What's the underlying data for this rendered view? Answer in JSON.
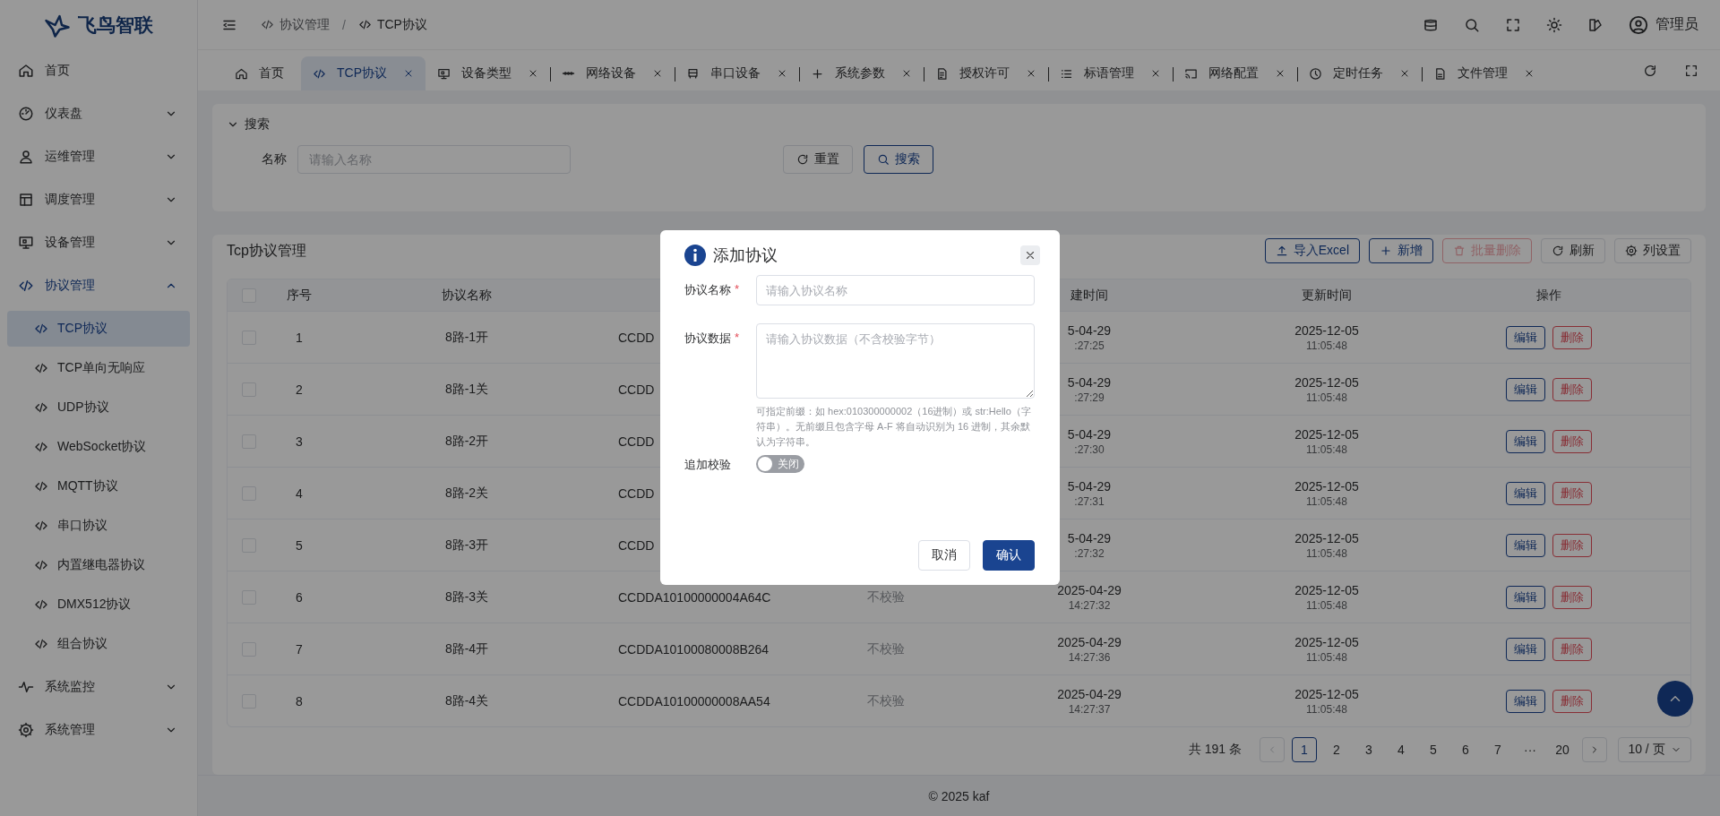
{
  "logo": {
    "text": "飞鸟智联"
  },
  "sidebar": {
    "items": [
      {
        "label": "首页",
        "kind": "link"
      },
      {
        "label": "仪表盘",
        "kind": "group",
        "expanded": false
      },
      {
        "label": "运维管理",
        "kind": "group",
        "expanded": false
      },
      {
        "label": "调度管理",
        "kind": "group",
        "expanded": false
      },
      {
        "label": "设备管理",
        "kind": "group",
        "expanded": false
      },
      {
        "label": "协议管理",
        "kind": "group",
        "expanded": true,
        "children": [
          {
            "label": "TCP协议",
            "selected": true
          },
          {
            "label": "TCP单向无响应",
            "selected": false
          },
          {
            "label": "UDP协议",
            "selected": false
          },
          {
            "label": "WebSocket协议",
            "selected": false
          },
          {
            "label": "MQTT协议",
            "selected": false
          },
          {
            "label": "串口协议",
            "selected": false
          },
          {
            "label": "内置继电器协议",
            "selected": false
          },
          {
            "label": "DMX512协议",
            "selected": false
          },
          {
            "label": "组合协议",
            "selected": false
          }
        ]
      },
      {
        "label": "系统监控",
        "kind": "group",
        "expanded": false
      },
      {
        "label": "系统管理",
        "kind": "group",
        "expanded": false
      }
    ]
  },
  "header": {
    "breadcrumb": [
      "协议管理",
      "TCP协议"
    ],
    "separator": "/",
    "user": "管理员"
  },
  "tabs": [
    {
      "label": "首页",
      "selected": false,
      "closable": false
    },
    {
      "label": "TCP协议",
      "selected": true,
      "closable": true
    },
    {
      "label": "设备类型",
      "selected": false,
      "closable": true
    },
    {
      "label": "网络设备",
      "selected": false,
      "closable": true
    },
    {
      "label": "串口设备",
      "selected": false,
      "closable": true
    },
    {
      "label": "系统参数",
      "selected": false,
      "closable": true
    },
    {
      "label": "授权许可",
      "selected": false,
      "closable": true
    },
    {
      "label": "标语管理",
      "selected": false,
      "closable": true
    },
    {
      "label": "网络配置",
      "selected": false,
      "closable": true
    },
    {
      "label": "定时任务",
      "selected": false,
      "closable": true
    },
    {
      "label": "文件管理",
      "selected": false,
      "closable": true
    }
  ],
  "search": {
    "title": "搜索",
    "expanded": true,
    "fields": [
      {
        "label": "名称",
        "placeholder": "请输入名称"
      }
    ],
    "buttons": [
      "重置",
      "搜索"
    ]
  },
  "table_card": {
    "title": "Tcp协议管理",
    "toolbar": [
      {
        "label": "导入Excel",
        "kind": "primary",
        "disabled": false
      },
      {
        "label": "新增",
        "kind": "primary",
        "disabled": false
      },
      {
        "label": "批量删除",
        "kind": "danger",
        "disabled": true
      },
      {
        "label": "刷新",
        "kind": "default",
        "disabled": false
      },
      {
        "label": "列设置",
        "kind": "default",
        "disabled": false
      }
    ],
    "table": {
      "header_checked": false,
      "columns": [
        "序号",
        "协议名称",
        "建时间",
        "更新时间",
        "操作"
      ],
      "rows": [
        {
          "checked": false,
          "index": "1",
          "name": "8路-1开",
          "data": "CCDD",
          "created_date": "5-04-29",
          "created_time": ":27:25",
          "updated_date": "2025-12-05",
          "updated_time": "11:05:48",
          "actions": [
            "编辑",
            "删除"
          ]
        },
        {
          "checked": false,
          "index": "2",
          "name": "8路-1关",
          "data": "CCDD",
          "created_date": "5-04-29",
          "created_time": ":27:29",
          "updated_date": "2025-12-05",
          "updated_time": "11:05:48",
          "actions": [
            "编辑",
            "删除"
          ]
        },
        {
          "checked": false,
          "index": "3",
          "name": "8路-2开",
          "data": "CCDD",
          "created_date": "5-04-29",
          "created_time": ":27:30",
          "updated_date": "2025-12-05",
          "updated_time": "11:05:48",
          "actions": [
            "编辑",
            "删除"
          ]
        },
        {
          "checked": false,
          "index": "4",
          "name": "8路-2关",
          "data": "CCDD",
          "created_date": "5-04-29",
          "created_time": ":27:31",
          "updated_date": "2025-12-05",
          "updated_time": "11:05:48",
          "actions": [
            "编辑",
            "删除"
          ]
        },
        {
          "checked": false,
          "index": "5",
          "name": "8路-3开",
          "data": "CCDD",
          "created_date": "5-04-29",
          "created_time": ":27:32",
          "updated_date": "2025-12-05",
          "updated_time": "11:05:48",
          "actions": [
            "编辑",
            "删除"
          ]
        },
        {
          "checked": false,
          "index": "6",
          "name": "8路-3关",
          "data": "CCDDA10100000004A64C",
          "check": "不校验",
          "created_date": "2025-04-29",
          "created_time": "14:27:32",
          "updated_date": "2025-12-05",
          "updated_time": "11:05:48",
          "actions": [
            "编辑",
            "删除"
          ]
        },
        {
          "checked": false,
          "index": "7",
          "name": "8路-4开",
          "data": "CCDDA10100080008B264",
          "check": "不校验",
          "created_date": "2025-04-29",
          "created_time": "14:27:36",
          "updated_date": "2025-12-05",
          "updated_time": "11:05:48",
          "actions": [
            "编辑",
            "删除"
          ]
        },
        {
          "checked": false,
          "index": "8",
          "name": "8路-4关",
          "data": "CCDDA10100000008AA54",
          "check": "不校验",
          "created_date": "2025-04-29",
          "created_time": "14:27:37",
          "updated_date": "2025-12-05",
          "updated_time": "11:05:48",
          "actions": [
            "编辑",
            "删除"
          ]
        }
      ]
    },
    "pagination": {
      "total": "共 191 条",
      "prev_disabled": true,
      "next_disabled": false,
      "pages": [
        {
          "label": "1",
          "selected": true
        },
        {
          "label": "2",
          "selected": false
        },
        {
          "label": "3",
          "selected": false
        },
        {
          "label": "4",
          "selected": false
        },
        {
          "label": "5",
          "selected": false
        },
        {
          "label": "6",
          "selected": false
        },
        {
          "label": "7",
          "selected": false
        },
        {
          "label": "···",
          "selected": false
        },
        {
          "label": "20",
          "selected": false
        }
      ],
      "page_size": "10 / 页"
    }
  },
  "footer": {
    "text": "© 2025 kaf"
  },
  "dialog": {
    "title": "添加协议",
    "fields": [
      {
        "kind": "input",
        "label": "协议名称",
        "required_mark": "*",
        "placeholder": "请输入协议名称"
      },
      {
        "kind": "textarea",
        "label": "协议数据",
        "required_mark": "*",
        "placeholder": "请输入协议数据（不含校验字节）",
        "hint": "可指定前缀：如 hex:010300000002（16进制）或 str:Hello（字符串）。无前缀且包含字母 A-F 将自动识别为 16 进制，其余默认为字符串。"
      },
      {
        "kind": "switch",
        "label": "追加校验",
        "on": false,
        "text": "关闭"
      }
    ],
    "buttons": [
      {
        "label": "取消",
        "kind": "default"
      },
      {
        "label": "确认",
        "kind": "primary"
      }
    ]
  }
}
